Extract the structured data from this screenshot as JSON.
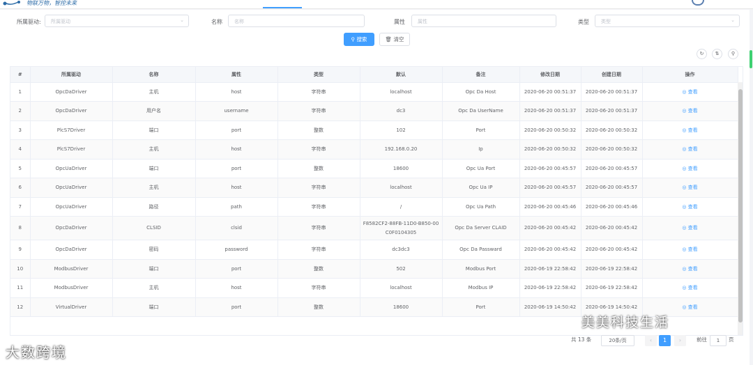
{
  "header": {
    "slogan": "物联万物，智控未来",
    "colors": {
      "accent": "#409eff",
      "logo": "#2d6ca8"
    }
  },
  "filters": {
    "driver_label": "所属驱动:",
    "driver_placeholder": "所属驱动",
    "name_label": "名称",
    "name_placeholder": "名称",
    "attr_label": "属性",
    "attr_placeholder": "属性",
    "type_label": "类型",
    "type_placeholder": "类型"
  },
  "actions": {
    "search_label": "搜索",
    "reset_label": "清空",
    "search_icon": "search-icon",
    "reset_icon": "trash-icon"
  },
  "table": {
    "headers": [
      "#",
      "所属驱动",
      "名称",
      "属性",
      "类型",
      "默认",
      "备注",
      "修改日期",
      "创建日期",
      "操作"
    ],
    "op_label": "查看",
    "rows": [
      {
        "no": "1",
        "driver": "OpcDaDriver",
        "name": "主机",
        "attr": "host",
        "type": "字符串",
        "default": "localhost",
        "remark": "Opc Da Host",
        "updated": "2020-06-20 00:51:37",
        "created": "2020-06-20 00:51:37"
      },
      {
        "no": "2",
        "driver": "OpcDaDriver",
        "name": "用户名",
        "attr": "username",
        "type": "字符串",
        "default": "dc3",
        "remark": "Opc Da UserName",
        "updated": "2020-06-20 00:51:37",
        "created": "2020-06-20 00:51:37"
      },
      {
        "no": "3",
        "driver": "PlcS7Driver",
        "name": "端口",
        "attr": "port",
        "type": "整数",
        "default": "102",
        "remark": "Port",
        "updated": "2020-06-20 00:50:32",
        "created": "2020-06-20 00:50:32"
      },
      {
        "no": "4",
        "driver": "PlcS7Driver",
        "name": "主机",
        "attr": "host",
        "type": "字符串",
        "default": "192.168.0.20",
        "remark": "Ip",
        "updated": "2020-06-20 00:50:32",
        "created": "2020-06-20 00:50:32"
      },
      {
        "no": "5",
        "driver": "OpcUaDriver",
        "name": "端口",
        "attr": "port",
        "type": "整数",
        "default": "18600",
        "remark": "Opc Ua Port",
        "updated": "2020-06-20 00:45:57",
        "created": "2020-06-20 00:45:57"
      },
      {
        "no": "6",
        "driver": "OpcUaDriver",
        "name": "主机",
        "attr": "host",
        "type": "字符串",
        "default": "localhost",
        "remark": "Opc Ua IP",
        "updated": "2020-06-20 00:45:57",
        "created": "2020-06-20 00:45:57"
      },
      {
        "no": "7",
        "driver": "OpcUaDriver",
        "name": "路径",
        "attr": "path",
        "type": "字符串",
        "default": "/",
        "remark": "Opc Ua Path",
        "updated": "2020-06-20 00:45:46",
        "created": "2020-06-20 00:45:46"
      },
      {
        "no": "8",
        "driver": "OpcDaDriver",
        "name": "CLSID",
        "attr": "clsid",
        "type": "字符串",
        "default": "F8582CF2-88FB-11D0-B850-00C0F0104305",
        "remark": "Opc Da Server CLAID",
        "updated": "2020-06-20 00:45:42",
        "created": "2020-06-20 00:45:42"
      },
      {
        "no": "9",
        "driver": "OpcDaDriver",
        "name": "密码",
        "attr": "password",
        "type": "字符串",
        "default": "dc3dc3",
        "remark": "Opc Da Passward",
        "updated": "2020-06-20 00:45:42",
        "created": "2020-06-20 00:45:42"
      },
      {
        "no": "10",
        "driver": "ModbusDriver",
        "name": "端口",
        "attr": "port",
        "type": "整数",
        "default": "502",
        "remark": "Modbus Port",
        "updated": "2020-06-19 22:58:42",
        "created": "2020-06-19 22:58:42"
      },
      {
        "no": "11",
        "driver": "ModbusDriver",
        "name": "主机",
        "attr": "host",
        "type": "字符串",
        "default": "localhost",
        "remark": "Modbus IP",
        "updated": "2020-06-19 22:58:42",
        "created": "2020-06-19 22:58:42"
      },
      {
        "no": "12",
        "driver": "VirtualDriver",
        "name": "端口",
        "attr": "port",
        "type": "整数",
        "default": "18600",
        "remark": "Port",
        "updated": "2020-06-19 14:50:42",
        "created": "2020-06-19 14:50:42"
      }
    ]
  },
  "pagination": {
    "total": "共 13 条",
    "page_size": "20条/页",
    "current": "1",
    "goto_label": "前往",
    "goto_value": "1",
    "page_unit": "页"
  },
  "watermarks": {
    "wechat": "美美科技生活",
    "bigdata": "大数跨境"
  }
}
